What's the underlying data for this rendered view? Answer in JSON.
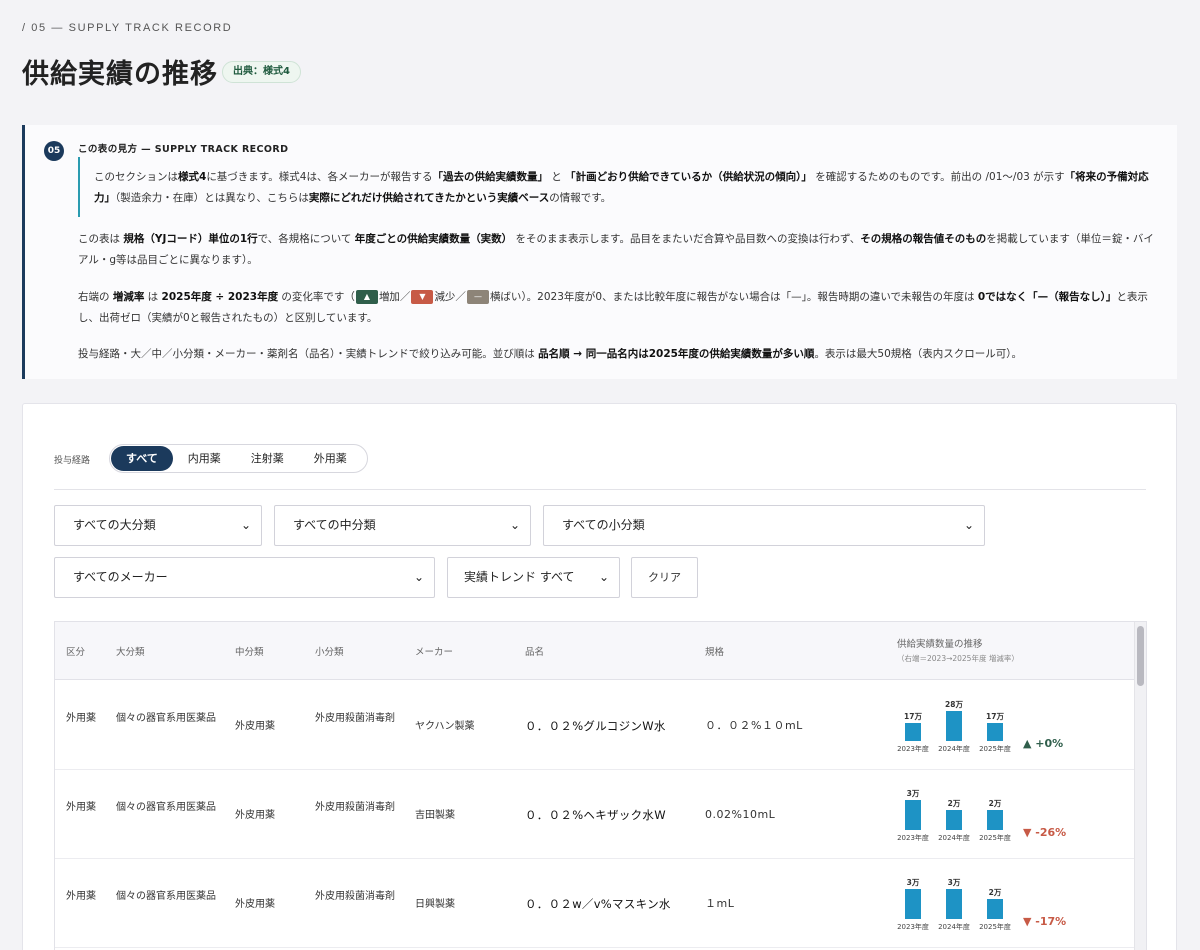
{
  "header": {
    "kicker": "/ 05 — SUPPLY TRACK RECORD",
    "title": "供給実績の推移",
    "source_badge": "出典：様式4"
  },
  "guide": {
    "number": "05",
    "heading": "この表の見方 — SUPPLY TRACK RECORD",
    "quote": {
      "a": "このセクションは",
      "b": "様式4",
      "c": "に基づきます。様式4は、各メーカーが報告する",
      "d": "「過去の供給実績数量」",
      "e": " と ",
      "f": "「計画どおり供給できているか（供給状況の傾向）」",
      "g": " を確認するためのものです。前出の /01〜/03 が示す",
      "h": "「将来の予備対応力」",
      "i": "（製造余力・在庫）とは異なり、こちらは",
      "j": "実際にどれだけ供給されてきたかという実績ベース",
      "k": "の情報です。"
    },
    "p1": {
      "a": "この表は ",
      "b": "規格（YJコード）単位の1行",
      "c": "で、各規格について ",
      "d": "年度ごとの供給実績数量（実数）",
      "e": " をそのまま表示します。品目をまたいだ合算や品目数への変換は行わず、",
      "f": "その規格の報告値そのもの",
      "g": "を掲載しています（単位＝錠・バイアル・g等は品目ごとに異なります）。"
    },
    "p2": {
      "a": "右端の ",
      "b": "増減率",
      "c": " は ",
      "d": "2025年度 ÷ 2023年度",
      "e": " の変化率です（",
      "chip_up": "▲",
      "up_label": "増加／",
      "chip_down": "▼",
      "down_label": "減少／",
      "chip_flat": "—",
      "flat_label": "横ばい",
      "f": "）。2023年度が0、または比較年度に報告がない場合は「—」。報告時期の違いで未報告の年度は ",
      "g": "0ではなく「—（報告なし）」",
      "h": "と表示し、出荷ゼロ（実績が0と報告されたもの）と区別しています。"
    },
    "p3": {
      "a": "投与経路・大／中／小分類・メーカー・薬剤名（品名）・実績トレンドで絞り込み可能。並び順は ",
      "b": "品名順 → 同一品名内は2025年度の供給実績数量が多い順",
      "c": "。表示は最大50規格（表内スクロール可）。"
    }
  },
  "filters": {
    "route_label": "投与経路",
    "route_tabs": [
      "すべて",
      "内用薬",
      "注射薬",
      "外用薬"
    ],
    "active_route": "すべて",
    "major": "すべての大分類",
    "middle": "すべての中分類",
    "minor": "すべての小分類",
    "maker": "すべてのメーカー",
    "trend": "実績トレンド すべて",
    "clear": "クリア"
  },
  "table": {
    "headers": {
      "category": "区分",
      "major": "大分類",
      "middle": "中分類",
      "minor": "小分類",
      "maker": "メーカー",
      "name": "品名",
      "spec": "規格",
      "trend": "供給実績数量の推移",
      "trend_sub": "（右端＝2023→2025年度 増減率）"
    },
    "years": [
      "2023年度",
      "2024年度",
      "2025年度"
    ],
    "rows": [
      {
        "category": "外用薬",
        "major": "個々の器官系用医薬品",
        "middle": "外皮用薬",
        "minor": "外皮用殺菌消毒剤",
        "maker": "ヤクハン製薬",
        "name": "０．０２%グルコジンW水",
        "spec": "０．０２%１０mL",
        "values": [
          17,
          28,
          17
        ],
        "value_labels": [
          "17万",
          "28万",
          "17万"
        ],
        "rate": "+0%",
        "direction": "up"
      },
      {
        "category": "外用薬",
        "major": "個々の器官系用医薬品",
        "middle": "外皮用薬",
        "minor": "外皮用殺菌消毒剤",
        "maker": "吉田製薬",
        "name": "０．０２%ヘキザック水W",
        "spec": "0.02%10mL",
        "values": [
          3,
          2,
          2
        ],
        "value_labels": [
          "3万",
          "2万",
          "2万"
        ],
        "rate": "-26%",
        "direction": "down"
      },
      {
        "category": "外用薬",
        "major": "個々の器官系用医薬品",
        "middle": "外皮用薬",
        "minor": "外皮用殺菌消毒剤",
        "maker": "日興製薬",
        "name": "０．０２w／v%マスキン水",
        "spec": "１mL",
        "values": [
          3,
          3,
          2
        ],
        "value_labels": [
          "3万",
          "3万",
          "2万"
        ],
        "rate": "-17%",
        "direction": "down"
      }
    ]
  },
  "colors": {
    "accent": "#1b3a5c",
    "bar": "#1e93c5",
    "up": "#2f5e4b",
    "down": "#c75a46",
    "flat": "#8d8478"
  }
}
